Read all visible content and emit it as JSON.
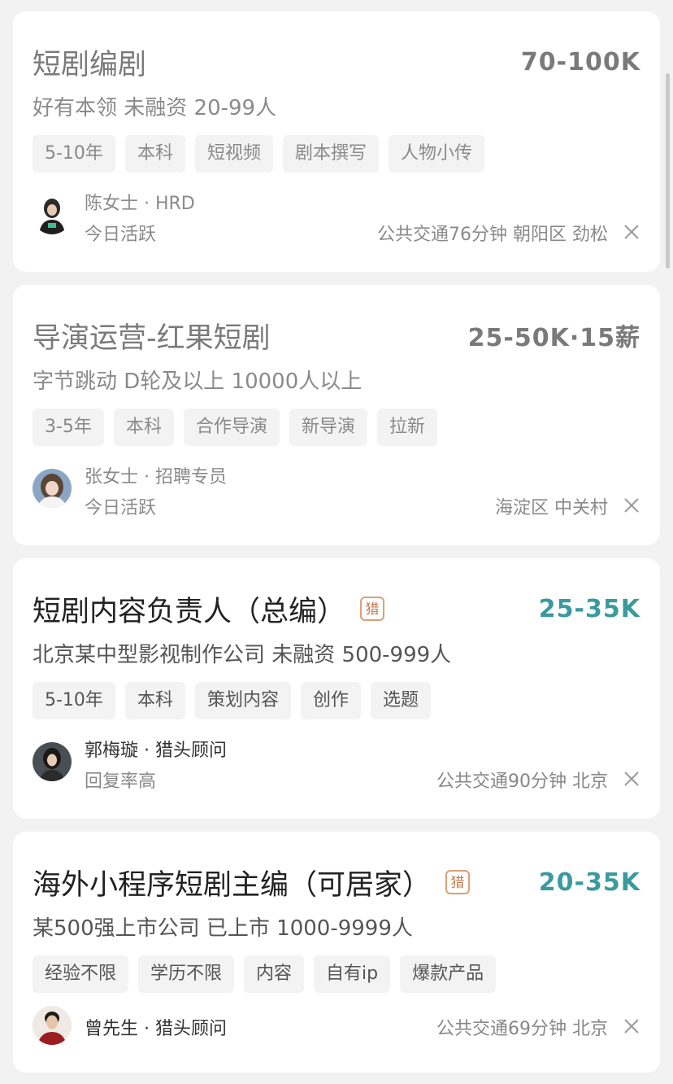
{
  "jobs": [
    {
      "title": "短剧编剧",
      "salary": "70-100K",
      "hunter": false,
      "company": "好有本领 未融资 20-99人",
      "tags": [
        "5-10年",
        "本科",
        "短视频",
        "剧本撰写",
        "人物小传"
      ],
      "recruiter": "陈女士 · HRD",
      "status": "今日活跃",
      "location": "公共交通76分钟 朝阳区 劲松"
    },
    {
      "title": "导演运营-红果短剧",
      "salary": "25-50K·15薪",
      "hunter": false,
      "company": "字节跳动 D轮及以上 10000人以上",
      "tags": [
        "3-5年",
        "本科",
        "合作导演",
        "新导演",
        "拉新"
      ],
      "recruiter": "张女士 · 招聘专员",
      "status": "今日活跃",
      "location": "海淀区 中关村"
    },
    {
      "title": "短剧内容负责人（总编）",
      "salary": "25-35K",
      "hunter": true,
      "hunter_label": "猎",
      "company": "北京某中型影视制作公司 未融资 500-999人",
      "tags": [
        "5-10年",
        "本科",
        "策划内容",
        "创作",
        "选题"
      ],
      "recruiter": "郭梅璇 · 猎头顾问",
      "status": "回复率高",
      "location": "公共交通90分钟 北京"
    },
    {
      "title": "海外小程序短剧主编（可居家）",
      "salary": "20-35K",
      "hunter": true,
      "hunter_label": "猎",
      "company": "某500强上市公司 已上市 1000-9999人",
      "tags": [
        "经验不限",
        "学历不限",
        "内容",
        "自有ip",
        "爆款产品"
      ],
      "recruiter": "曾先生 · 猎头顾问",
      "status": "",
      "location": "公共交通69分钟 北京"
    }
  ],
  "icons": {
    "close": "close-icon",
    "hunter_badge": "hunter-badge-icon"
  },
  "colors": {
    "salary_active": "#3b9a9e",
    "viewed_text": "#7a7a7a",
    "hunter_badge": "#c47c4d"
  }
}
